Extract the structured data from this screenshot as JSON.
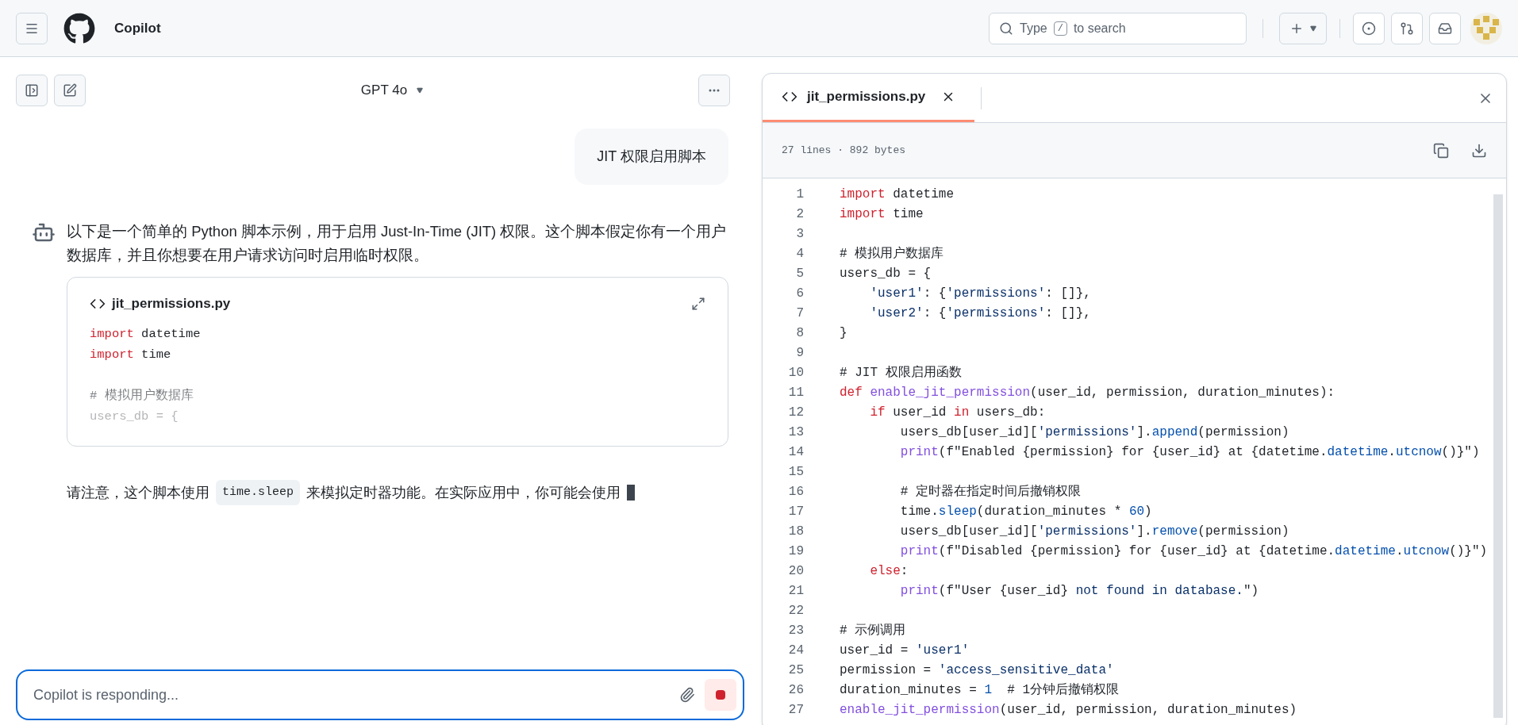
{
  "header": {
    "title": "Copilot",
    "search": {
      "prefix": "Type",
      "key": "/",
      "suffix": "to search"
    }
  },
  "chat": {
    "model": "GPT 4o",
    "user_message": "JIT 权限启用脚本",
    "intro": "以下是一个简单的 Python 脚本示例，用于启用 Just-In-Time (JIT) 权限。这个脚本假定你有一个用户数据库，并且你想要在用户请求访问时启用临时权限。",
    "preview": {
      "filename": "jit_permissions.py",
      "lines": [
        {
          "kind": "code",
          "tokens": [
            {
              "kind": "kw",
              "text": "import"
            },
            {
              "kind": "plain",
              "text": " datetime"
            }
          ]
        },
        {
          "kind": "code",
          "tokens": [
            {
              "kind": "kw",
              "text": "import"
            },
            {
              "kind": "plain",
              "text": " time"
            }
          ]
        },
        {
          "kind": "blank"
        },
        {
          "kind": "code",
          "tokens": [
            {
              "kind": "comment",
              "text": "# 模拟用户数据库"
            }
          ]
        },
        {
          "kind": "code",
          "tokens": [
            {
              "kind": "plain",
              "text": "users_db = {"
            }
          ]
        }
      ]
    },
    "note": {
      "before": "请注意，这个脚本使用",
      "code": "time.sleep",
      "after": "来模拟定时器功能。在实际应用中，你可能会使用"
    },
    "streaming": true,
    "input": {
      "placeholder": "Copilot is responding..."
    }
  },
  "code_panel": {
    "tab": {
      "filename": "jit_permissions.py",
      "selected": true
    },
    "info": "27 lines · 892 bytes",
    "lines": [
      {
        "number": "1",
        "tokens": [
          {
            "kind": "kw",
            "text": "import"
          },
          {
            "kind": "plain",
            "text": " datetime"
          }
        ]
      },
      {
        "number": "2",
        "tokens": [
          {
            "kind": "kw",
            "text": "import"
          },
          {
            "kind": "plain",
            "text": " time"
          }
        ]
      },
      {
        "number": "3"
      },
      {
        "number": "4",
        "tokens": [
          {
            "kind": "comment",
            "text": "# 模拟用户数据库"
          }
        ]
      },
      {
        "number": "5",
        "tokens": [
          {
            "kind": "plain",
            "text": "users_db = {"
          }
        ]
      },
      {
        "number": "6",
        "tokens": [
          {
            "kind": "str",
            "text": "    'user1'"
          },
          {
            "kind": "plain",
            "text": ": {"
          },
          {
            "kind": "str",
            "text": "'permissions'"
          },
          {
            "kind": "plain",
            "text": ": []},"
          }
        ]
      },
      {
        "number": "7",
        "tokens": [
          {
            "kind": "str",
            "text": "    'user2'"
          },
          {
            "kind": "plain",
            "text": ": {"
          },
          {
            "kind": "str",
            "text": "'permissions'"
          },
          {
            "kind": "plain",
            "text": ": []},"
          }
        ]
      },
      {
        "number": "8",
        "tokens": [
          {
            "kind": "plain",
            "text": "}"
          }
        ]
      },
      {
        "number": "9"
      },
      {
        "number": "10",
        "tokens": [
          {
            "kind": "comment",
            "text": "# JIT 权限启用函数"
          }
        ]
      },
      {
        "number": "11",
        "tokens": [
          {
            "kind": "kw",
            "text": "def "
          },
          {
            "kind": "fn",
            "text": "enable_jit_permission"
          },
          {
            "kind": "plain",
            "text": "(user_id, permission, duration_minutes):"
          }
        ]
      },
      {
        "number": "12",
        "tokens": [
          {
            "kind": "kw",
            "text": "    if"
          },
          {
            "kind": "plain",
            "text": " user_id "
          },
          {
            "kind": "kw",
            "text": "in"
          },
          {
            "kind": "plain",
            "text": " users_db:"
          }
        ]
      },
      {
        "number": "13",
        "tokens": [
          {
            "kind": "plain",
            "text": "        users_db[user_id]["
          },
          {
            "kind": "str",
            "text": "'permissions'"
          },
          {
            "kind": "plain",
            "text": "]."
          },
          {
            "kind": "prop",
            "text": "append"
          },
          {
            "kind": "plain",
            "text": "(permission)"
          }
        ]
      },
      {
        "number": "14",
        "tokens": [
          {
            "kind": "fn",
            "text": "        print"
          },
          {
            "kind": "plain",
            "text": "(f\"Enabled {permission} for {user_id} at {datetime."
          },
          {
            "kind": "prop",
            "text": "datetime"
          },
          {
            "kind": "plain",
            "text": "."
          },
          {
            "kind": "prop",
            "text": "utcnow"
          },
          {
            "kind": "plain",
            "text": "()}\")"
          }
        ]
      },
      {
        "number": "15"
      },
      {
        "number": "16",
        "tokens": [
          {
            "kind": "comment",
            "text": "        # 定时器在指定时间后撤销权限"
          }
        ]
      },
      {
        "number": "17",
        "tokens": [
          {
            "kind": "plain",
            "text": "        time."
          },
          {
            "kind": "prop",
            "text": "sleep"
          },
          {
            "kind": "plain",
            "text": "(duration_minutes * "
          },
          {
            "kind": "num",
            "text": "60"
          },
          {
            "kind": "plain",
            "text": ")"
          }
        ]
      },
      {
        "number": "18",
        "tokens": [
          {
            "kind": "plain",
            "text": "        users_db[user_id]["
          },
          {
            "kind": "str",
            "text": "'permissions'"
          },
          {
            "kind": "plain",
            "text": "]."
          },
          {
            "kind": "prop",
            "text": "remove"
          },
          {
            "kind": "plain",
            "text": "(permission)"
          }
        ]
      },
      {
        "number": "19",
        "tokens": [
          {
            "kind": "fn",
            "text": "        print"
          },
          {
            "kind": "plain",
            "text": "(f\"Disabled {permission} for {user_id} at {datetime."
          },
          {
            "kind": "prop",
            "text": "datetime"
          },
          {
            "kind": "plain",
            "text": "."
          },
          {
            "kind": "prop",
            "text": "utcnow"
          },
          {
            "kind": "plain",
            "text": "()}\")"
          }
        ]
      },
      {
        "number": "20",
        "tokens": [
          {
            "kind": "kw",
            "text": "    else"
          },
          {
            "kind": "plain",
            "text": ":"
          }
        ]
      },
      {
        "number": "21",
        "tokens": [
          {
            "kind": "fn",
            "text": "        print"
          },
          {
            "kind": "plain",
            "text": "(f\"User {user_id} "
          },
          {
            "kind": "str",
            "text": "not found in database."
          },
          {
            "kind": "plain",
            "text": "\")"
          }
        ]
      },
      {
        "number": "22"
      },
      {
        "number": "23",
        "tokens": [
          {
            "kind": "comment",
            "text": "# 示例调用"
          }
        ]
      },
      {
        "number": "24",
        "tokens": [
          {
            "kind": "plain",
            "text": "user_id = "
          },
          {
            "kind": "str",
            "text": "'user1'"
          }
        ]
      },
      {
        "number": "25",
        "tokens": [
          {
            "kind": "plain",
            "text": "permission = "
          },
          {
            "kind": "str",
            "text": "'access_sensitive_data'"
          }
        ]
      },
      {
        "number": "26",
        "tokens": [
          {
            "kind": "plain",
            "text": "duration_minutes = "
          },
          {
            "kind": "num",
            "text": "1"
          },
          {
            "kind": "comment",
            "text": "  # 1分钟后撤销权限"
          }
        ]
      },
      {
        "number": "27",
        "tokens": [
          {
            "kind": "fn",
            "text": "enable_jit_permission"
          },
          {
            "kind": "plain",
            "text": "(user_id, permission, duration_minutes)"
          }
        ]
      }
    ]
  }
}
